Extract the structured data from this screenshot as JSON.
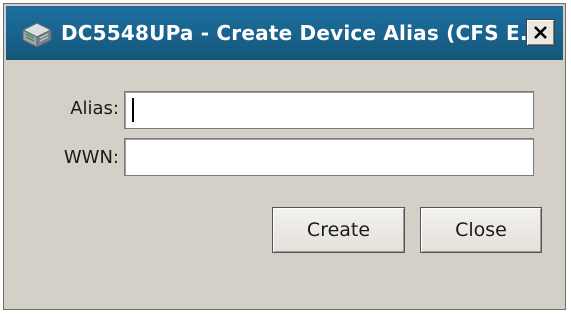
{
  "window": {
    "title": "DC5548UPa - Create Device Alias (CFS E...",
    "close_glyph": "✕",
    "accent_color": "#1a648f"
  },
  "form": {
    "alias_label": "Alias:",
    "alias_value": "",
    "wwn_label": "WWN:",
    "wwn_value": ""
  },
  "buttons": {
    "create_label": "Create",
    "close_label": "Close"
  },
  "icons": {
    "app": "switch-device-icon",
    "close": "close-icon"
  }
}
